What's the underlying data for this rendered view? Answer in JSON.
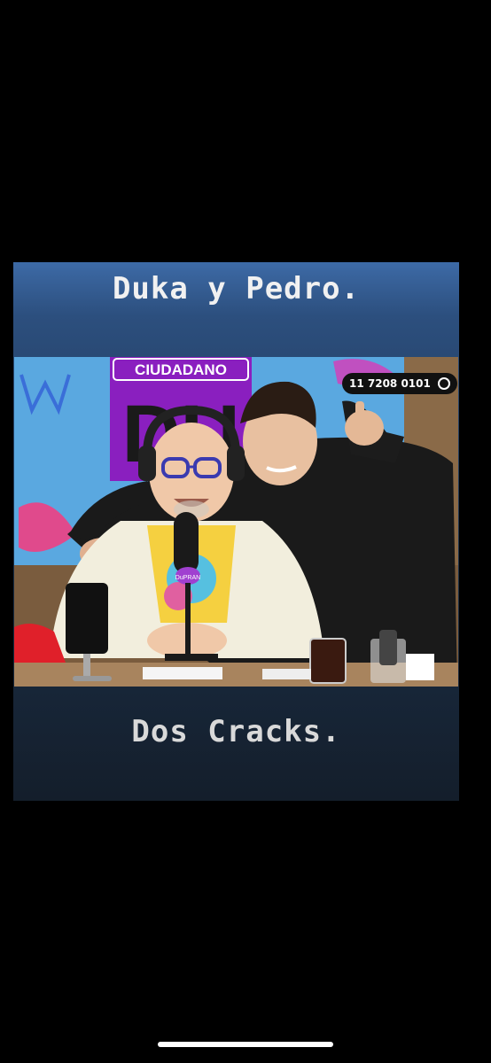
{
  "story": {
    "caption_top": "Duka y Pedro.",
    "caption_bottom": "Dos Cracks."
  },
  "photo": {
    "show_title": "CIUDADANO",
    "show_title_part": "DU",
    "phone_number": "11 7208 0101",
    "whatsapp_icon": "whatsapp-icon",
    "mic_brand": "DuPRAN"
  }
}
